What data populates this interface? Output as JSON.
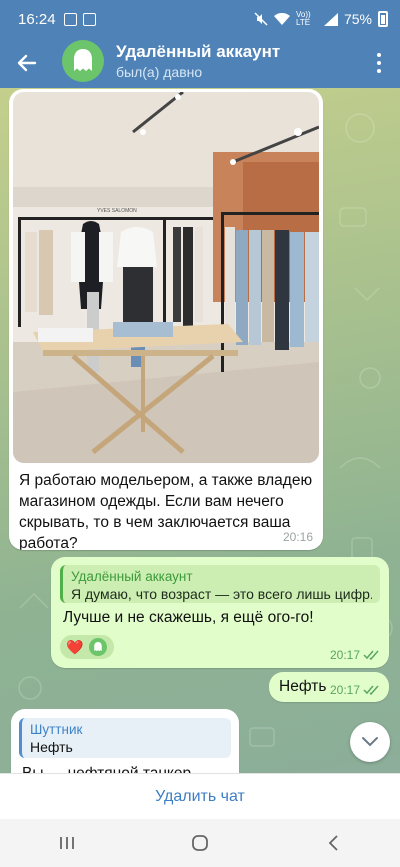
{
  "status_bar": {
    "time": "16:24",
    "network": "Vo)) LTE",
    "battery_percent": "75%"
  },
  "header": {
    "title": "Удалённый аккаунт",
    "subtitle": "был(а) давно"
  },
  "messages": {
    "photo_message": {
      "text": "Я работаю модельером, а также владею магазином одежды. Если вам нечего скрывать, то в чем заключается ваша работа?",
      "time": "20:16",
      "store_sign": "YVES SALOMON"
    },
    "reply_message": {
      "quote_author": "Удалённый аккаунт",
      "quote_text": "Я думаю, что возраст — это всего лишь цифр...",
      "text": "Лучше и не скажешь, я ещё ого-го!",
      "time": "20:17",
      "reaction": "❤️"
    },
    "short_message": {
      "text": "Нефть",
      "time": "20:17"
    },
    "incoming_partial": {
      "quote_author": "Шуттник",
      "quote_text": "Нефть",
      "text": "Вы — нефтяной танкер..."
    }
  },
  "bottom_bar": {
    "delete_label": "Удалить чат"
  },
  "colors": {
    "header": "#4f82b6",
    "out_bubble": "#e1fdca",
    "accent_green": "#4faf49",
    "link_blue": "#3d7ec4"
  }
}
